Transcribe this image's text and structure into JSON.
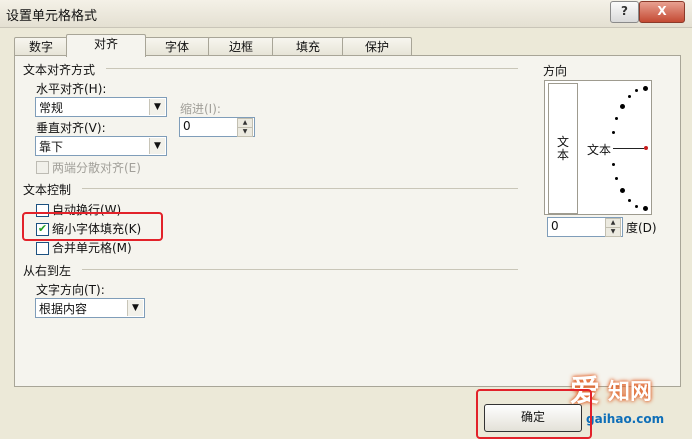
{
  "window": {
    "title": "设置单元格格式",
    "help_label": "?",
    "close_label": "X"
  },
  "tabs": [
    {
      "label": "数字"
    },
    {
      "label": "对齐",
      "active": true
    },
    {
      "label": "字体"
    },
    {
      "label": "边框"
    },
    {
      "label": "填充"
    },
    {
      "label": "保护"
    }
  ],
  "text_alignment": {
    "section_label": "文本对齐方式",
    "horizontal_label": "水平对齐(H):",
    "horizontal_value": "常规",
    "indent_label": "缩进(I):",
    "indent_value": "0",
    "vertical_label": "垂直对齐(V):",
    "vertical_value": "靠下",
    "distributed_label": "两端分散对齐(E)"
  },
  "text_control": {
    "section_label": "文本控制",
    "wrap_label": "自动换行(W)",
    "wrap_checked": false,
    "shrink_label": "缩小字体填充(K)",
    "shrink_checked": true,
    "merge_label": "合并单元格(M)",
    "merge_checked": false
  },
  "rtl": {
    "section_label": "从右到左",
    "direction_label": "文字方向(T):",
    "direction_value": "根据内容"
  },
  "orientation": {
    "section_label": "方向",
    "vertical_text": "文本",
    "horizontal_text": "文本",
    "degrees_value": "0",
    "degrees_label": "度(D)"
  },
  "buttons": {
    "ok_label": "确定"
  },
  "watermark": {
    "line1": "爱",
    "line2": "知网",
    "url": "gaihao.com"
  },
  "colors": {
    "highlight": "#e2222a",
    "accent": "#1c5180"
  }
}
